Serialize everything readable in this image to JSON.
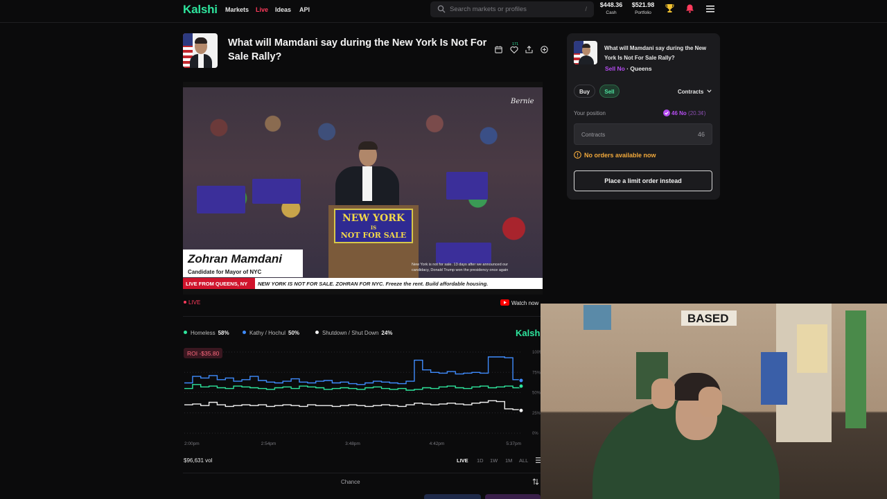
{
  "nav": {
    "logo": "Kalshi",
    "links": [
      "Markets",
      "Live",
      "Ideas",
      "API"
    ],
    "search_placeholder": "Search markets or profiles",
    "search_shortcut": "/",
    "cash_amount": "$448.36",
    "cash_label": "Cash",
    "portfolio_amount": "$521.98",
    "portfolio_label": "Portfolio",
    "notification_count": "171",
    "icons": [
      "search-icon",
      "trophy-icon",
      "bell-icon",
      "menu-icon"
    ]
  },
  "market": {
    "title": "What will Mamdani say during the New York Is Not For Sale Rally?",
    "header_icons": [
      "calendar-icon",
      "heart-icon",
      "share-icon",
      "add-icon"
    ]
  },
  "video": {
    "watermark": "Bernie",
    "podium_line1": "NEW YORK",
    "podium_line2": "IS",
    "podium_line3": "NOT FOR SALE",
    "lower_third_name": "Zohran Mamdani",
    "lower_third_role": "Candidate for Mayor of NYC",
    "quote": "New York is not for sale. 13 days after we announced our candidacy, Donald Trump won the presidency once again",
    "ticker_live": "LIVE FROM QUEENS, NY",
    "ticker_text": "NEW YORK IS NOT FOR SALE. ZOHRAN FOR NYC.  Freeze the rent. Build affordable housing.",
    "live_label": "LIVE",
    "watch_now": "Watch now"
  },
  "chart_data": {
    "type": "line",
    "series": [
      {
        "name": "Homeless",
        "pct": "58%",
        "color": "#2ee59d",
        "values": [
          55,
          60,
          57,
          58,
          56,
          55,
          58,
          57,
          56,
          55,
          54,
          56,
          57,
          55,
          58,
          57,
          56,
          54,
          55,
          56,
          55,
          54,
          56,
          57,
          55,
          54,
          55,
          53,
          54,
          56,
          55,
          57,
          58,
          56,
          55,
          57,
          58,
          56,
          57,
          58,
          56,
          58
        ]
      },
      {
        "name": "Kathy / Hochul",
        "pct": "50%",
        "color": "#3f8cff",
        "values": [
          62,
          70,
          68,
          71,
          66,
          68,
          64,
          66,
          70,
          65,
          63,
          62,
          64,
          67,
          63,
          62,
          64,
          65,
          62,
          63,
          61,
          60,
          62,
          64,
          63,
          62,
          61,
          64,
          90,
          78,
          75,
          74,
          76,
          73,
          74,
          75,
          74,
          94,
          94,
          93,
          66,
          65
        ]
      },
      {
        "name": "Shutdown / Shut Down",
        "pct": "24%",
        "color": "#f2f2f2",
        "values": [
          35,
          36,
          34,
          38,
          35,
          33,
          34,
          35,
          34,
          35,
          33,
          34,
          35,
          34,
          33,
          35,
          34,
          34,
          33,
          34,
          35,
          34,
          33,
          34,
          35,
          34,
          33,
          35,
          37,
          36,
          35,
          36,
          37,
          36,
          35,
          37,
          38,
          40,
          39,
          30,
          29,
          28
        ]
      }
    ],
    "x_ticks": [
      "2:00pm",
      "2:54pm",
      "3:48pm",
      "4:42pm",
      "5:37pm"
    ],
    "y_ticks": [
      "100%",
      "75%",
      "50%",
      "25%",
      "0%"
    ],
    "ylim": [
      0,
      100
    ],
    "legend_placement": "top-left",
    "watermark": "Kalshi",
    "roi": "ROI -$35.80",
    "volume": "$96,631 vol",
    "ranges": [
      "LIVE",
      "1D",
      "1W",
      "1M",
      "ALL"
    ],
    "active_range": "LIVE"
  },
  "footer": {
    "chance_label": "Chance"
  },
  "panel": {
    "title": "What will Mamdani say during the New York Is Not For Sale Rally?",
    "side_label": "Sell No",
    "separator": "·",
    "option": "Queens",
    "buy_label": "Buy",
    "sell_label": "Sell",
    "unit_select": "Contracts",
    "position_label": "Your position",
    "position_value": "46 No",
    "position_price": "(20.3¢)",
    "contracts_label": "Contracts",
    "contracts_value": "46",
    "warning": "No orders available now",
    "limit_button": "Place a limit order instead",
    "accent_purple": "#b44cf0",
    "accent_green": "#2ee59d"
  },
  "webcam": {
    "poster_text": "BASED"
  }
}
